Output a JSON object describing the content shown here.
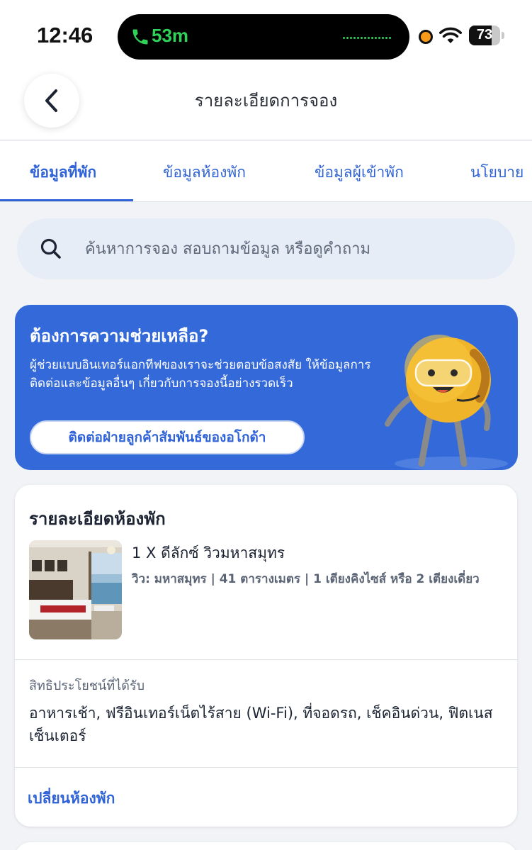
{
  "status_bar": {
    "time": "12:46",
    "call_duration": "53m",
    "battery": "73",
    "battery_level": 0.73,
    "icons": [
      "phone-icon",
      "waveform-icon",
      "privacy-dot-icon",
      "wifi-icon",
      "battery-icon"
    ],
    "call_color": "#30d158",
    "privacy_dot_color": "#f79a1a"
  },
  "header": {
    "title": "รายละเอียดการจอง",
    "back_icon": "chevron-left-icon"
  },
  "tabs": [
    {
      "label": "ข้อมูลที่พัก",
      "active": true
    },
    {
      "label": "ข้อมูลห้องพัก",
      "active": false
    },
    {
      "label": "ข้อมูลผู้เข้าพัก",
      "active": false
    },
    {
      "label": "นโยบาย",
      "active": false
    }
  ],
  "search": {
    "placeholder": "ค้นหาการจอง สอบถามข้อมูล หรือดูคำถาม",
    "icon": "search-icon"
  },
  "help": {
    "title": "ต้องการความช่วยเหลือ?",
    "body": "ผู้ช่วยแบบอินเทอร์แอกทีฟของเราจะช่วยตอบข้อสงสัย ให้ข้อมูลการติดต่อและข้อมูลอื่นๆ เกี่ยวกับการจองนี้อย่างรวดเร็ว",
    "button": "ติดต่อฝ่ายลูกค้าสัมพันธ์ของอโกด้า",
    "mascot_icon": "support-mascot-illustration",
    "background_color": "#3469d9"
  },
  "room_details": {
    "heading": "รายละเอียดห้องพัก",
    "room_name": "1 X ดีลักซ์ วิวมหาสมุทร",
    "room_info": "วิว: มหาสมุทร | 41 ตารางเมตร | 1 เตียงคิงไซส์ หรือ 2 เตียงเดี่ยว",
    "benefits_label": "สิทธิประโยชน์ที่ได้รับ",
    "benefits": "อาหารเช้า, ฟรีอินเทอร์เน็ตไร้สาย (Wi-Fi), ที่จอดรถ, เช็คอินด่วน, ฟิตเนสเซ็นเตอร์",
    "change_room": "เปลี่ยนห้องพัก"
  },
  "colors": {
    "accent": "#2f62d6",
    "page_background": "#f1f3f6",
    "search_background": "#e7edf7"
  }
}
